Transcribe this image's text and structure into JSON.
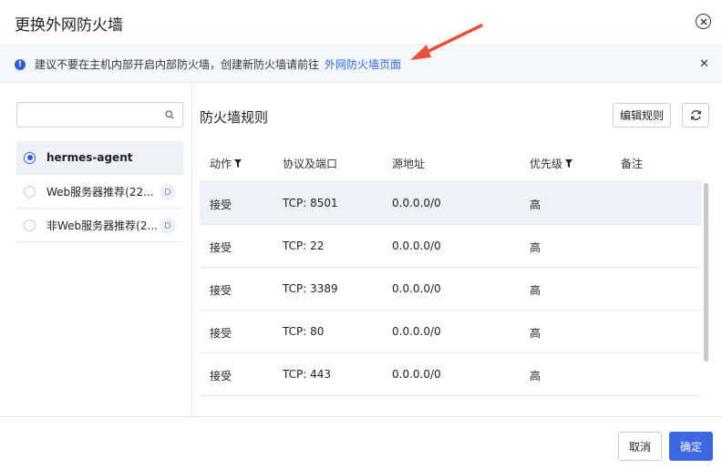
{
  "dialog": {
    "title": "更换外网防火墙"
  },
  "notice": {
    "text": "建议不要在主机内部开启内部防火墙，创建新防火墙请前往",
    "link": "外网防火墙页面"
  },
  "firewall_list": {
    "search_placeholder": "",
    "items": [
      {
        "label": "hermes-agent",
        "selected": true,
        "badge": ""
      },
      {
        "label": "Web服务器推荐(22...",
        "selected": false,
        "badge": "D"
      },
      {
        "label": "非Web服务器推荐(2...",
        "selected": false,
        "badge": "D"
      }
    ]
  },
  "rules": {
    "title": "防火墙规则",
    "edit_label": "编辑规则",
    "columns": [
      "动作",
      "协议及端口",
      "源地址",
      "优先级",
      "备注"
    ],
    "rows": [
      {
        "action": "接受",
        "port": "TCP: 8501",
        "source": "0.0.0.0/0",
        "priority": "高",
        "note": ""
      },
      {
        "action": "接受",
        "port": "TCP: 22",
        "source": "0.0.0.0/0",
        "priority": "高",
        "note": ""
      },
      {
        "action": "接受",
        "port": "TCP: 3389",
        "source": "0.0.0.0/0",
        "priority": "高",
        "note": ""
      },
      {
        "action": "接受",
        "port": "TCP: 80",
        "source": "0.0.0.0/0",
        "priority": "高",
        "note": ""
      },
      {
        "action": "接受",
        "port": "TCP: 443",
        "source": "0.0.0.0/0",
        "priority": "高",
        "note": ""
      }
    ]
  },
  "footer": {
    "cancel_label": "取消",
    "ok_label": "确定"
  },
  "colors": {
    "accent": "#3d67e3",
    "link": "#2f6ae6",
    "arrow": "#e8503a"
  }
}
